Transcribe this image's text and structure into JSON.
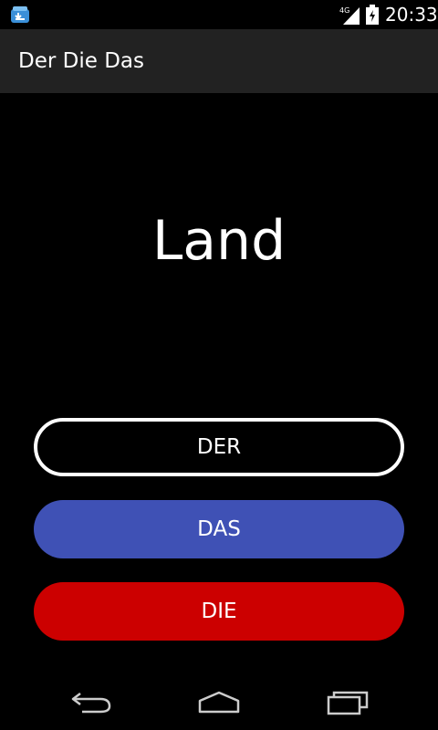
{
  "status_bar": {
    "time": "20:33",
    "network_label": "4G",
    "app_icon": "download-notification-icon",
    "signal_icon": "signal-icon",
    "battery_icon": "battery-charging-icon"
  },
  "action_bar": {
    "title": "Der Die Das"
  },
  "quiz": {
    "word": "Land"
  },
  "answers": {
    "der_label": "DER",
    "das_label": "DAS",
    "die_label": "DIE"
  },
  "colors": {
    "das_button": "#3f51b5",
    "die_button": "#cc0000",
    "der_border": "#ffffff"
  },
  "nav_bar": {
    "back_icon": "back-icon",
    "home_icon": "home-icon",
    "recents_icon": "recents-icon"
  }
}
